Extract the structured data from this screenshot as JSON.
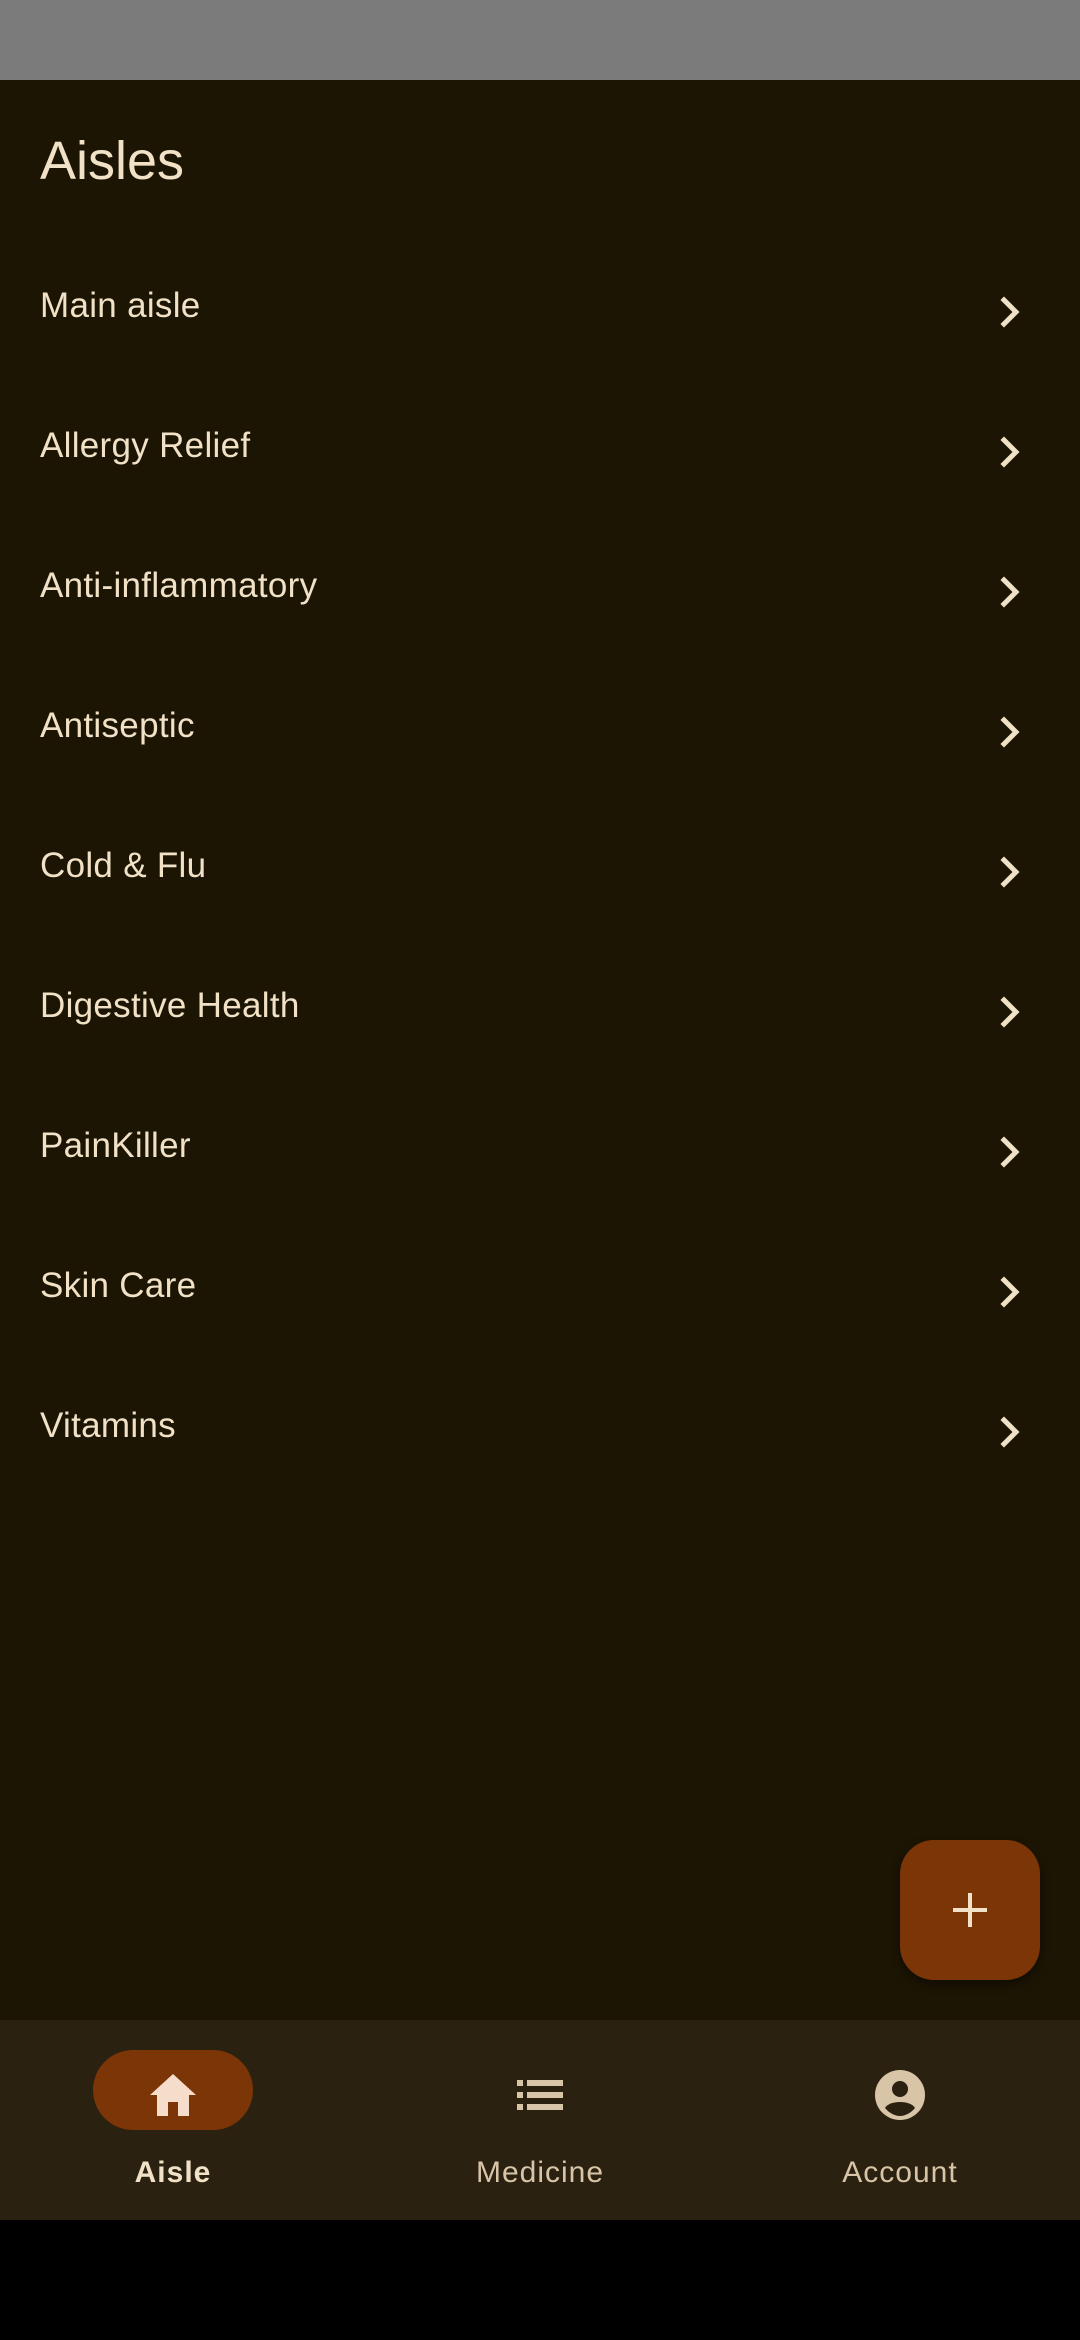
{
  "header": {
    "title": "Aisles"
  },
  "aisles": [
    {
      "label": "Main aisle",
      "icon": "chevron-right-icon"
    },
    {
      "label": "Allergy Relief",
      "icon": "chevron-right-icon"
    },
    {
      "label": "Anti-inflammatory",
      "icon": "chevron-right-icon"
    },
    {
      "label": "Antiseptic",
      "icon": "chevron-right-icon"
    },
    {
      "label": "Cold & Flu",
      "icon": "chevron-right-icon"
    },
    {
      "label": "Digestive Health",
      "icon": "chevron-right-icon"
    },
    {
      "label": "PainKiller",
      "icon": "chevron-right-icon"
    },
    {
      "label": "Skin Care",
      "icon": "chevron-right-icon"
    },
    {
      "label": "Vitamins",
      "icon": "chevron-right-icon"
    }
  ],
  "fab": {
    "icon": "plus-icon"
  },
  "bottom_nav": {
    "items": [
      {
        "label": "Aisle",
        "icon": "home-icon",
        "selected": true
      },
      {
        "label": "Medicine",
        "icon": "list-icon",
        "selected": false
      },
      {
        "label": "Account",
        "icon": "account-circle-icon",
        "selected": false
      }
    ]
  },
  "colors": {
    "background": "#1c1504",
    "text": "#f1e1c6",
    "accent": "#7b3506",
    "nav_background": "#2b2111",
    "status_bar": "#7b7b7b"
  }
}
